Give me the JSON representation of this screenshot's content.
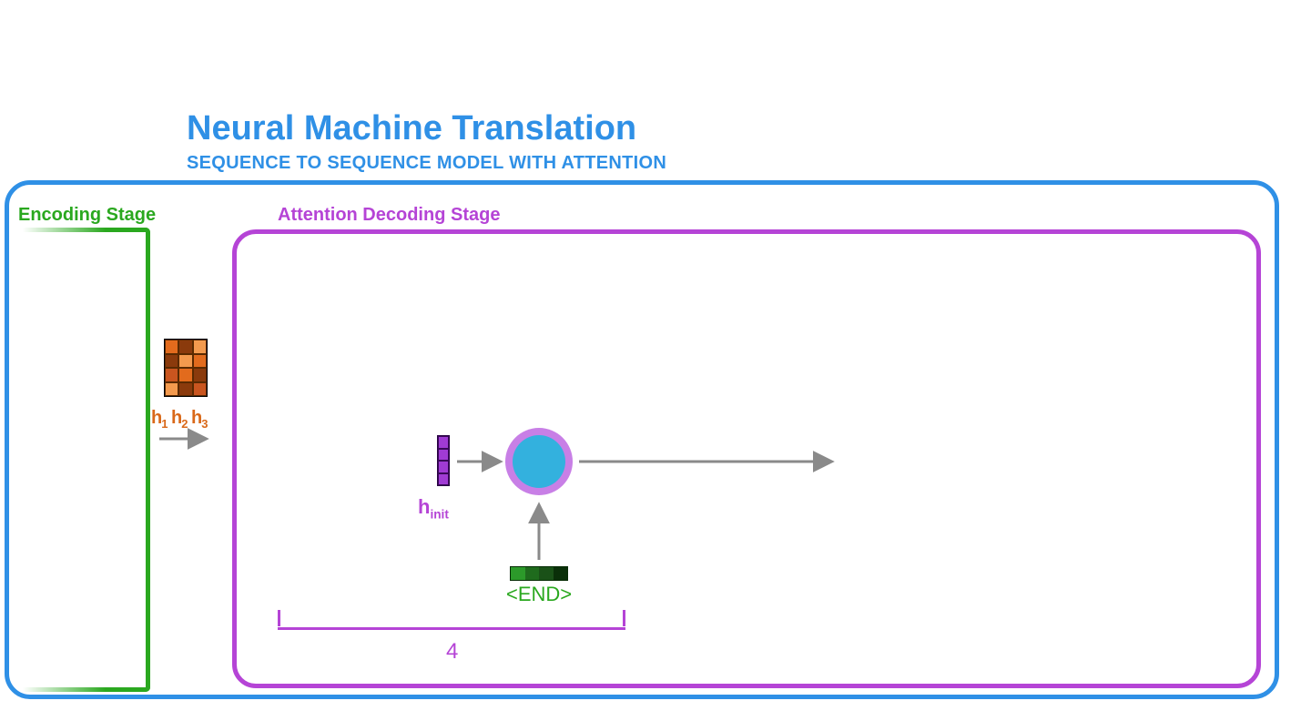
{
  "title": "Neural Machine Translation",
  "subtitle": "SEQUENCE TO SEQUENCE MODEL WITH ATTENTION",
  "encoding_stage": {
    "label": "Encoding Stage"
  },
  "decoding_stage": {
    "label": "Attention Decoding Stage"
  },
  "hidden_states": {
    "labels": [
      "h",
      "h",
      "h"
    ],
    "subs": [
      "1",
      "2",
      "3"
    ]
  },
  "hinit": {
    "label": "h",
    "sub": "init"
  },
  "input_token": {
    "label": "<END>"
  },
  "bracket": {
    "number": "4"
  },
  "colors": {
    "blue": "#2F90E6",
    "green": "#2AA81F",
    "purple": "#B544D6",
    "orange": "#D9691A",
    "node_outer": "#C87FE6",
    "node_inner": "#33B1DE"
  }
}
